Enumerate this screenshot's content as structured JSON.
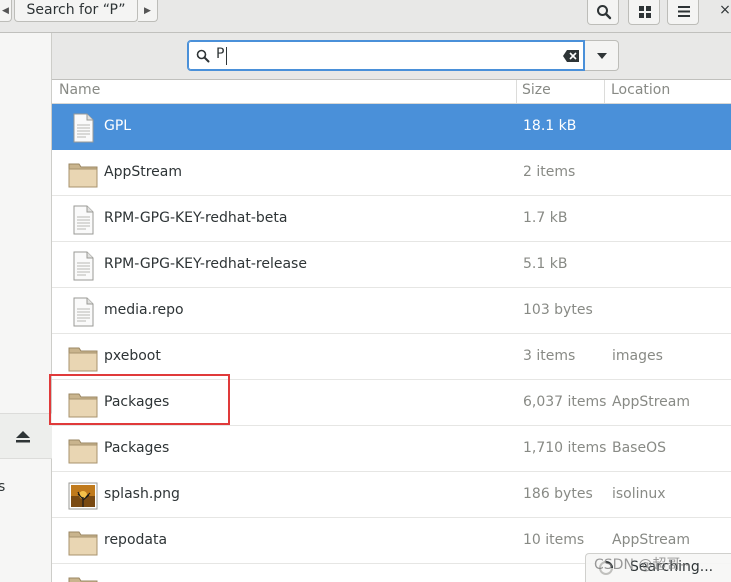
{
  "header": {
    "path_label": "Search for “P”",
    "back_icon": "chevron-left-icon",
    "forward_icon": "chevron-right-icon",
    "search_toggle_icon": "search-icon",
    "view_grid_icon": "grid-icon",
    "menu_icon": "hamburger-menu-icon",
    "close_label": "×"
  },
  "sidebar": {
    "eject_icon": "eject-icon",
    "fragment_text": "s"
  },
  "search": {
    "value": "P",
    "clear_icon": "clear-icon",
    "dropdown_icon": "chevron-down-icon"
  },
  "columns": {
    "name": "Name",
    "size": "Size",
    "location": "Location"
  },
  "files": [
    {
      "name": "GPL",
      "size": "18.1 kB",
      "location": "",
      "icon": "document-icon",
      "selected": true
    },
    {
      "name": "AppStream",
      "size": "2 items",
      "location": "",
      "icon": "folder-icon",
      "selected": false
    },
    {
      "name": "RPM-GPG-KEY-redhat-beta",
      "size": "1.7 kB",
      "location": "",
      "icon": "document-icon",
      "selected": false
    },
    {
      "name": "RPM-GPG-KEY-redhat-release",
      "size": "5.1 kB",
      "location": "",
      "icon": "document-icon",
      "selected": false
    },
    {
      "name": "media.repo",
      "size": "103 bytes",
      "location": "",
      "icon": "document-icon",
      "selected": false
    },
    {
      "name": "pxeboot",
      "size": "3 items",
      "location": "images",
      "icon": "folder-icon",
      "selected": false
    },
    {
      "name": "Packages",
      "size": "6,037 items",
      "location": "AppStream",
      "icon": "folder-icon",
      "selected": false
    },
    {
      "name": "Packages",
      "size": "1,710 items",
      "location": "BaseOS",
      "icon": "folder-icon",
      "selected": false
    },
    {
      "name": "splash.png",
      "size": "186 bytes",
      "location": "isolinux",
      "icon": "image-thumbnail-icon",
      "selected": false
    },
    {
      "name": "repodata",
      "size": "10 items",
      "location": "AppStream",
      "icon": "folder-icon",
      "selected": false
    },
    {
      "name": "",
      "size": "",
      "location": "",
      "icon": "folder-icon",
      "selected": false
    }
  ],
  "status": {
    "searching": "Searching..."
  },
  "watermark": "CSDN @超哥--",
  "colors": {
    "selection": "#4a90d9",
    "highlight_box": "#e03a3a",
    "folder": "#e9d6b3"
  }
}
